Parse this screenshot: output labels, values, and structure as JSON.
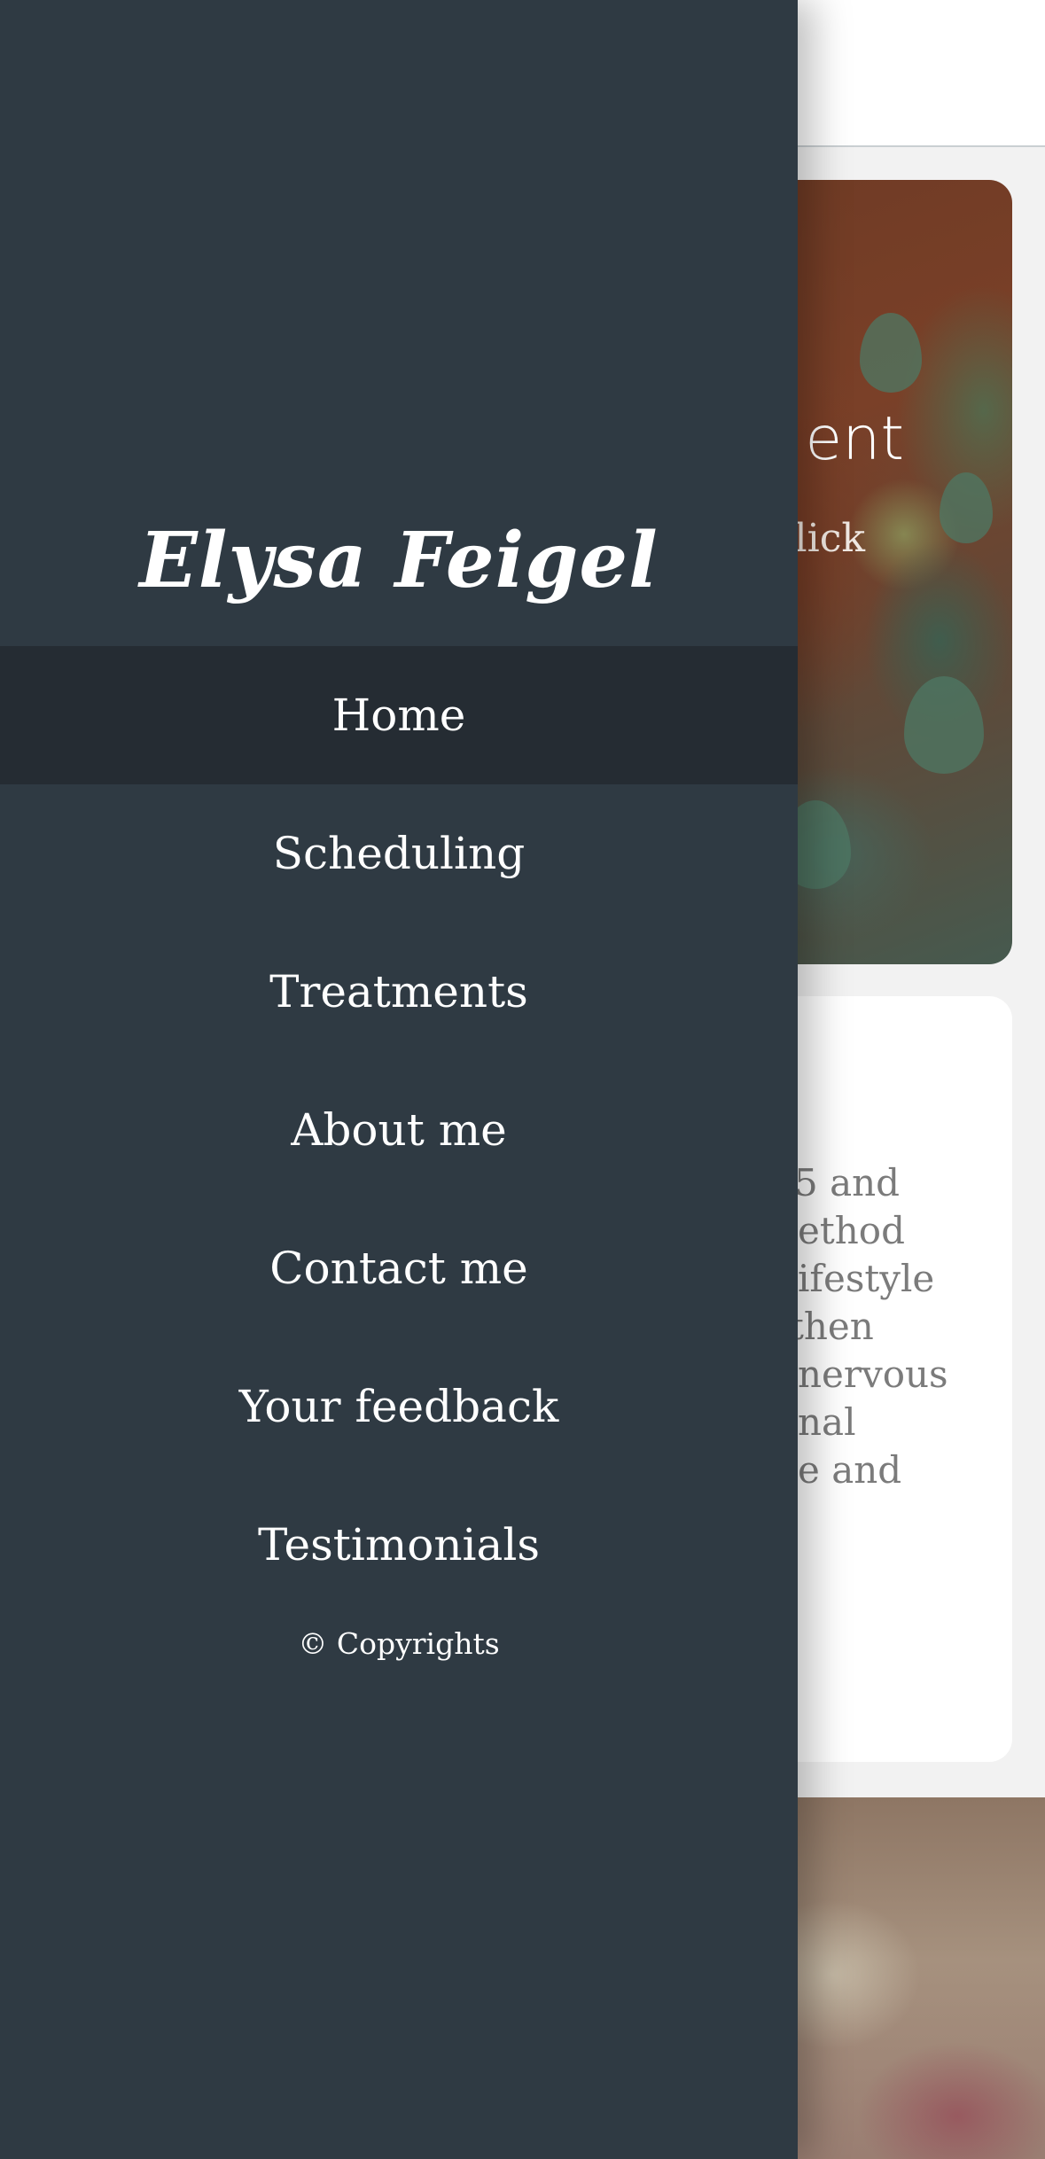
{
  "page": {
    "hero": {
      "title_fragment": "ent",
      "subtitle_fragment": "lick"
    },
    "body_text_fragments": [
      "5 and",
      "ethod",
      "ifestyle",
      " then",
      " nervous",
      "nal",
      "e and"
    ]
  },
  "drawer": {
    "brand": "Elysa Feigel",
    "nav": [
      {
        "label": "Home",
        "active": true
      },
      {
        "label": "Scheduling",
        "active": false
      },
      {
        "label": "Treatments",
        "active": false
      },
      {
        "label": "About me",
        "active": false
      },
      {
        "label": "Contact me",
        "active": false
      },
      {
        "label": "Your feedback",
        "active": false
      },
      {
        "label": "Testimonials",
        "active": false
      }
    ],
    "copyright": "© Copyrights"
  },
  "colors": {
    "drawer_bg": "#2f3a43",
    "active_item_bg": "#252c33",
    "page_bg": "#f2f2f2"
  }
}
